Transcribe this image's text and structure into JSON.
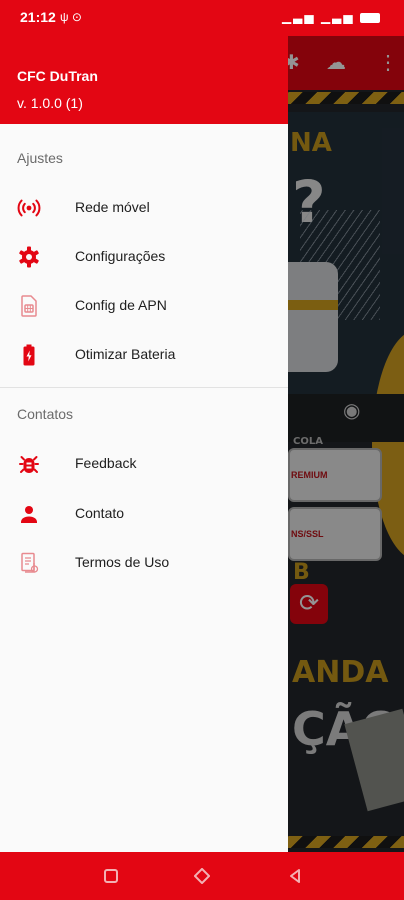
{
  "status_bar": {
    "time": "21:12",
    "left_icons": "ψ ⊙",
    "right_icons": "▁▃▅ ▁▃▅"
  },
  "drawer": {
    "app_name": "CFC DuTran",
    "version": "v. 1.0.0 (1)",
    "sections": [
      {
        "title": "Ajustes",
        "items": [
          {
            "label": "Rede móvel",
            "icon": "cell-tower-icon"
          },
          {
            "label": "Configurações",
            "icon": "gear-icon"
          },
          {
            "label": "Config de APN",
            "icon": "sim-card-icon"
          },
          {
            "label": "Otimizar Bateria",
            "icon": "battery-charging-icon"
          }
        ]
      },
      {
        "title": "Contatos",
        "items": [
          {
            "label": "Feedback",
            "icon": "bug-icon"
          },
          {
            "label": "Contato",
            "icon": "person-icon"
          },
          {
            "label": "Termos de Uso",
            "icon": "document-icon"
          }
        ]
      }
    ]
  },
  "background_app": {
    "input_1_text": "REMIUM",
    "input_2_text": "NS/SSL",
    "poster_text_1": "NA",
    "poster_text_2": "?",
    "poster_text_3": "ANDA",
    "poster_text_4": "ÇÃO",
    "poster_text_5": "B",
    "poster_text_6": "COLA"
  },
  "colors": {
    "accent": "#e30613",
    "drawer_bg": "#fafafa"
  }
}
